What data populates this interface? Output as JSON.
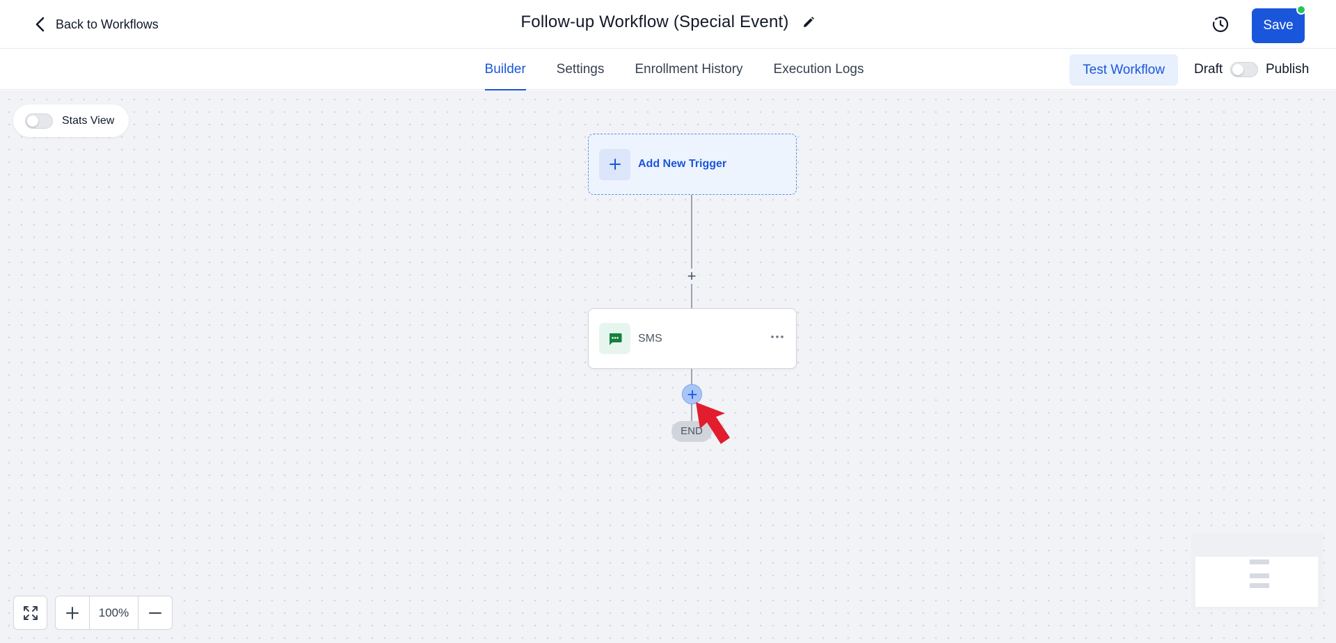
{
  "header": {
    "back_label": "Back to Workflows",
    "title": "Follow-up Workflow (Special Event)",
    "save_label": "Save",
    "accent_color": "#1a56db",
    "status_dot_color": "#22c55e"
  },
  "tabs": [
    {
      "label": "Builder",
      "active": true
    },
    {
      "label": "Settings",
      "active": false
    },
    {
      "label": "Enrollment History",
      "active": false
    },
    {
      "label": "Execution Logs",
      "active": false
    }
  ],
  "actions": {
    "test_label": "Test Workflow",
    "draft_label": "Draft",
    "publish_label": "Publish",
    "published": false
  },
  "canvas": {
    "stats_label": "Stats View",
    "stats_enabled": false,
    "trigger_label": "Add New Trigger",
    "action_node": {
      "label": "SMS",
      "icon": "sms-icon"
    },
    "end_label": "END"
  },
  "zoom": {
    "level": "100%"
  }
}
